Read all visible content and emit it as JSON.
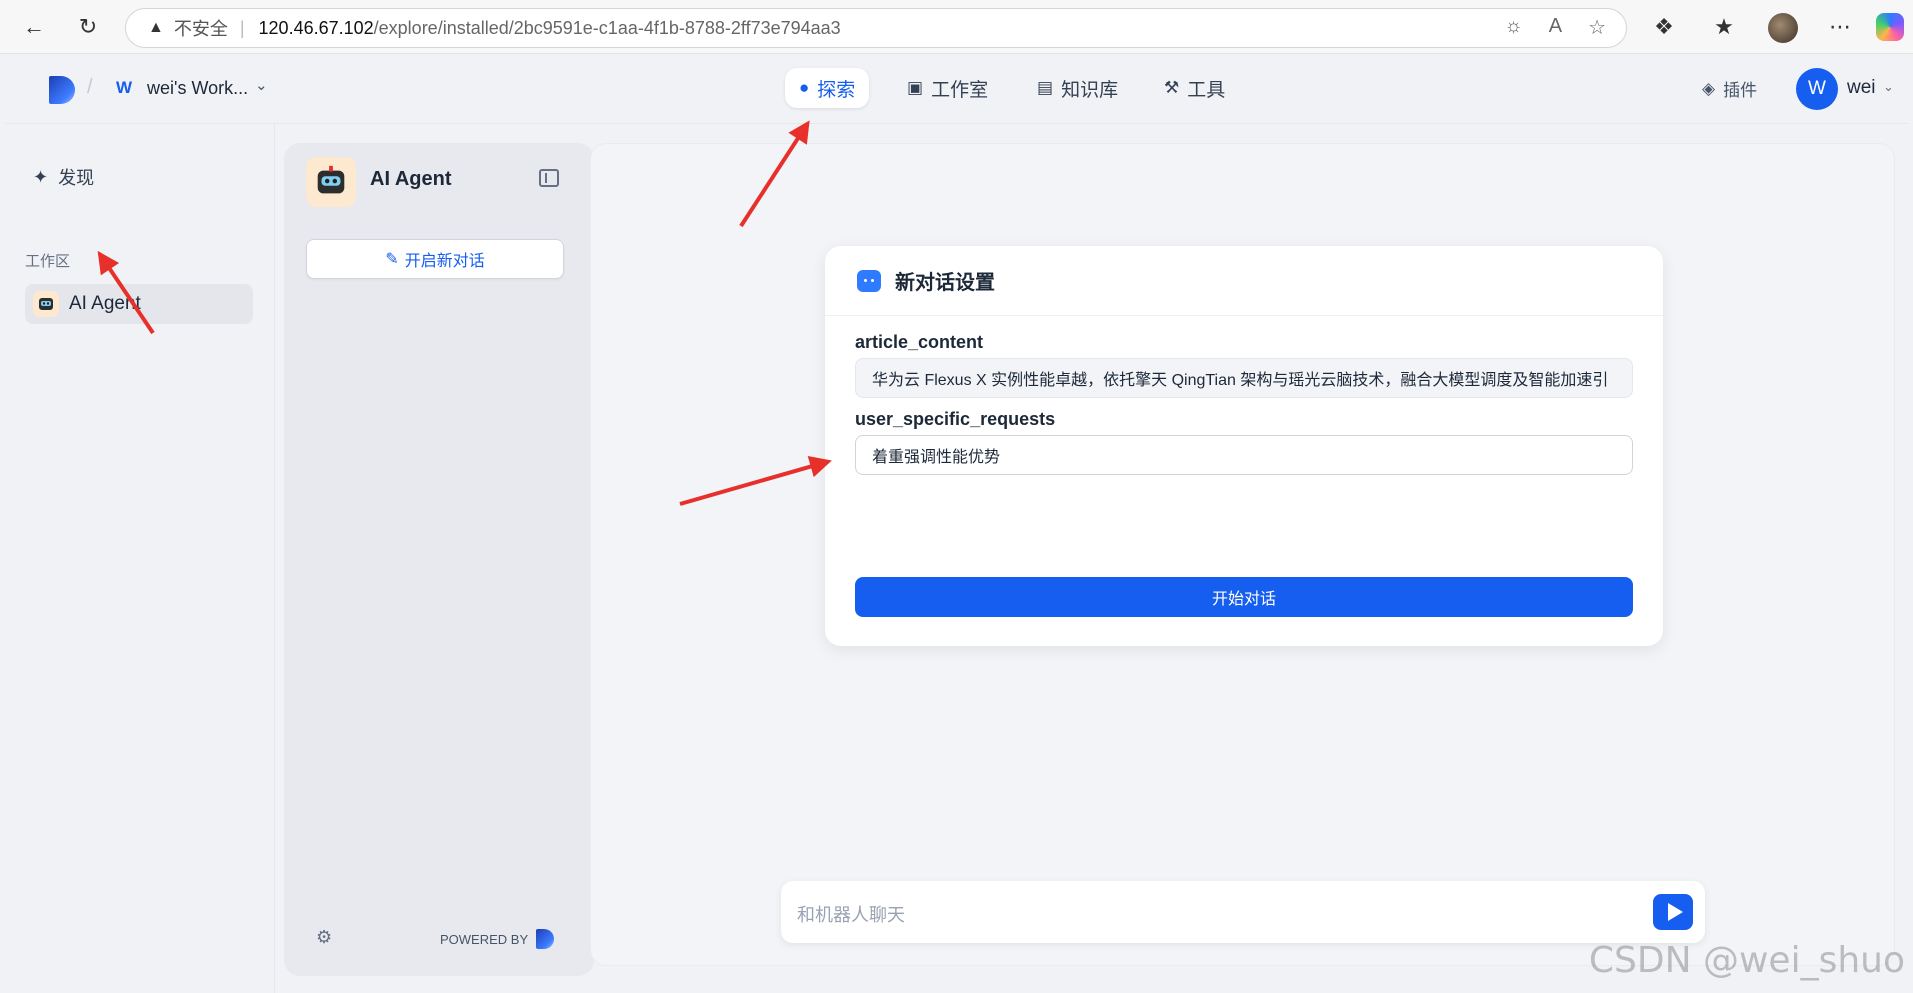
{
  "browser": {
    "security_label": "不安全",
    "url_host": "120.46.67.102",
    "url_path": "/explore/installed/2bc9591e-c1aa-4f1b-8788-2ff73e794aa3"
  },
  "header": {
    "workspace_badge": "W",
    "workspace_name": "wei's Work...",
    "tabs": [
      {
        "label": "探索",
        "icon": "explore-icon",
        "active": true
      },
      {
        "label": "工作室",
        "icon": "robot-icon",
        "active": false
      },
      {
        "label": "知识库",
        "icon": "book-icon",
        "active": false
      },
      {
        "label": "工具",
        "icon": "hammer-icon",
        "active": false
      }
    ],
    "plugin_label": "插件",
    "user_initial": "W",
    "user_name": "wei"
  },
  "sidebar": {
    "discover_label": "发现",
    "workspace_section_label": "工作区",
    "items": [
      {
        "label": "AI Agent"
      }
    ]
  },
  "chat_panel": {
    "agent_name": "AI Agent",
    "new_chat_label": "开启新对话",
    "powered_by": "POWERED BY"
  },
  "settings_card": {
    "title": "新对话设置",
    "fields": [
      {
        "label": "article_content",
        "value": "华为云 Flexus X 实例性能卓越，依托擎天 QingTian 架构与瑶光云脑技术，融合大模型调度及智能加速引"
      },
      {
        "label": "user_specific_requests",
        "value": "着重强调性能优势"
      }
    ],
    "start_button": "开始对话"
  },
  "chat_input": {
    "placeholder": "和机器人聊天"
  },
  "watermark": "CSDN @wei_shuo",
  "colors": {
    "accent": "#155eef",
    "annotation_arrow": "#e8302b"
  }
}
